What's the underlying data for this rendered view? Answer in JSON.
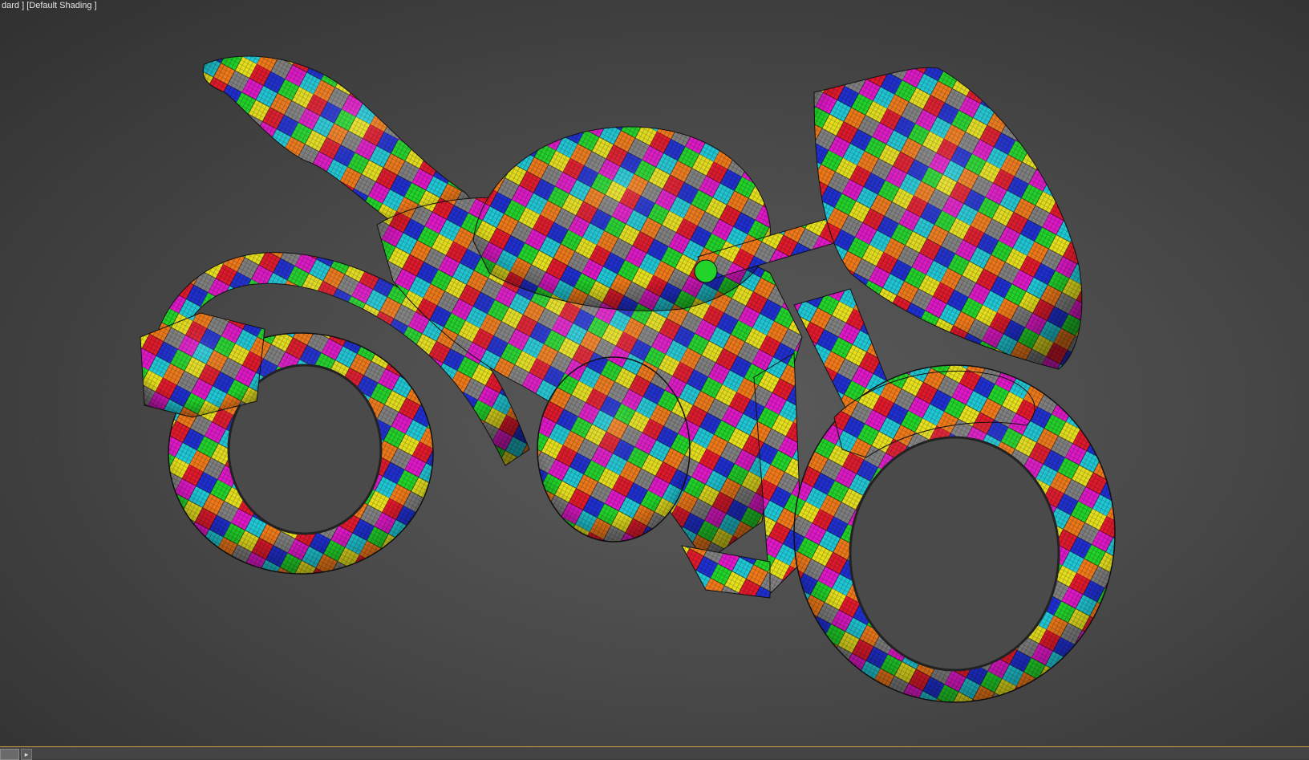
{
  "viewport": {
    "label_shading_mode": "dard ]",
    "label_display_mode": "[Default Shading ]"
  },
  "timeline": {
    "next_icon": "play-arrow-icon"
  },
  "colors": {
    "checker_palette": [
      "#e01a2c",
      "#1f2fd0",
      "#22d42a",
      "#e6e01e",
      "#e018c8",
      "#20c8d6",
      "#f07a1a",
      "#808080"
    ],
    "background_center": "#5b5b5b",
    "background_edge": "#303030",
    "timeline_accent": "#c8a040"
  }
}
